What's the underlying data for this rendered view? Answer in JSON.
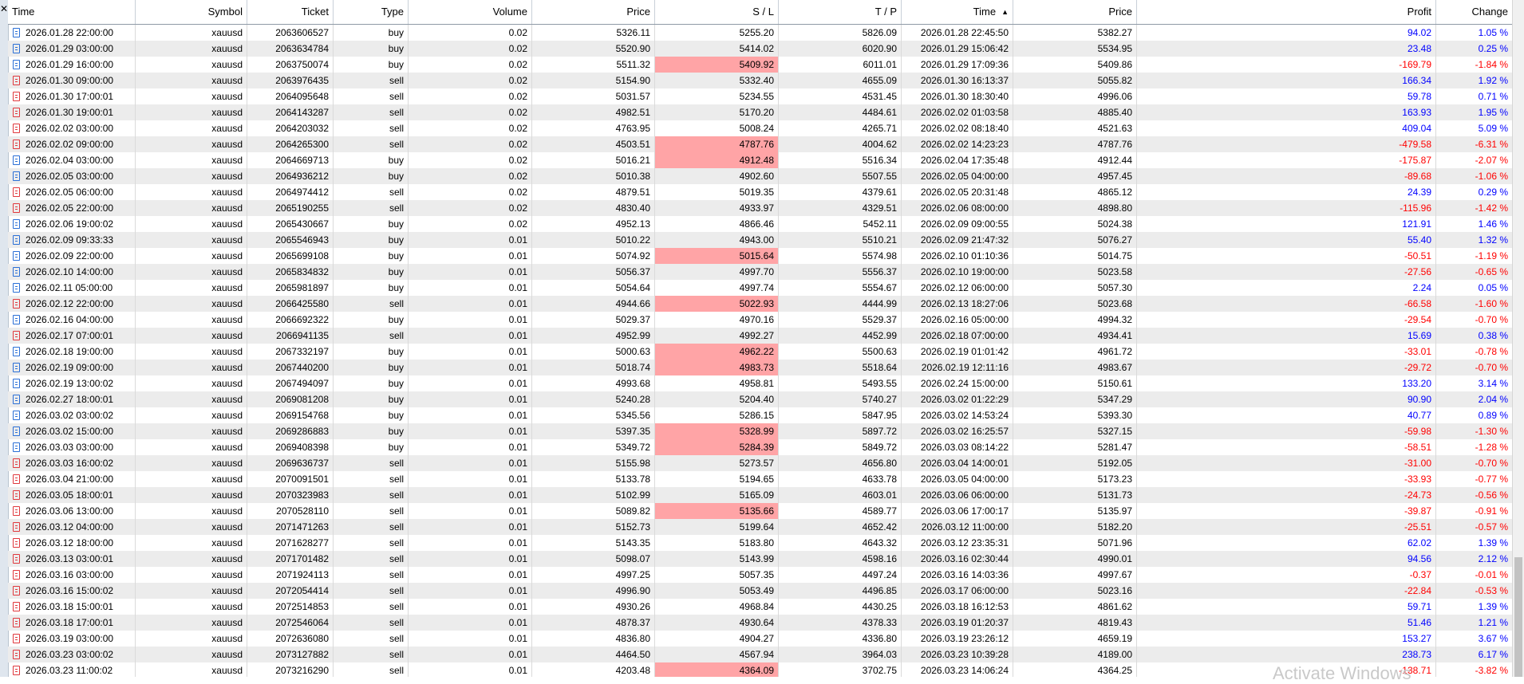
{
  "headers": {
    "time": "Time",
    "symbol": "Symbol",
    "ticket": "Ticket",
    "type": "Type",
    "volume": "Volume",
    "price": "Price",
    "sl": "S / L",
    "tp": "T / P",
    "close_time": "Time",
    "close_price": "Price",
    "profit": "Profit",
    "change": "Change"
  },
  "close_icon": "close-icon",
  "watermark": "Activate Windows",
  "colors": {
    "profit_positive": "#0000ff",
    "profit_negative": "#ff0000",
    "sl_highlight": "#ffa4a6",
    "row_alt": "#ececec"
  },
  "rows": [
    {
      "time": "2026.01.28 22:00:00",
      "symbol": "xauusd",
      "ticket": "2063606527",
      "type": "buy",
      "volume": "0.02",
      "price": "5326.11",
      "sl": "5255.20",
      "sl_hit": false,
      "tp": "5826.09",
      "close_time": "2026.01.28 22:45:50",
      "close_price": "5382.27",
      "profit": "94.02",
      "change": "1.05 %"
    },
    {
      "time": "2026.01.29 03:00:00",
      "symbol": "xauusd",
      "ticket": "2063634784",
      "type": "buy",
      "volume": "0.02",
      "price": "5520.90",
      "sl": "5414.02",
      "sl_hit": false,
      "tp": "6020.90",
      "close_time": "2026.01.29 15:06:42",
      "close_price": "5534.95",
      "profit": "23.48",
      "change": "0.25 %"
    },
    {
      "time": "2026.01.29 16:00:00",
      "symbol": "xauusd",
      "ticket": "2063750074",
      "type": "buy",
      "volume": "0.02",
      "price": "5511.32",
      "sl": "5409.92",
      "sl_hit": true,
      "tp": "6011.01",
      "close_time": "2026.01.29 17:09:36",
      "close_price": "5409.86",
      "profit": "-169.79",
      "change": "-1.84 %"
    },
    {
      "time": "2026.01.30 09:00:00",
      "symbol": "xauusd",
      "ticket": "2063976435",
      "type": "sell",
      "volume": "0.02",
      "price": "5154.90",
      "sl": "5332.40",
      "sl_hit": false,
      "tp": "4655.09",
      "close_time": "2026.01.30 16:13:37",
      "close_price": "5055.82",
      "profit": "166.34",
      "change": "1.92 %"
    },
    {
      "time": "2026.01.30 17:00:01",
      "symbol": "xauusd",
      "ticket": "2064095648",
      "type": "sell",
      "volume": "0.02",
      "price": "5031.57",
      "sl": "5234.55",
      "sl_hit": false,
      "tp": "4531.45",
      "close_time": "2026.01.30 18:30:40",
      "close_price": "4996.06",
      "profit": "59.78",
      "change": "0.71 %"
    },
    {
      "time": "2026.01.30 19:00:01",
      "symbol": "xauusd",
      "ticket": "2064143287",
      "type": "sell",
      "volume": "0.02",
      "price": "4982.51",
      "sl": "5170.20",
      "sl_hit": false,
      "tp": "4484.61",
      "close_time": "2026.02.02 01:03:58",
      "close_price": "4885.40",
      "profit": "163.93",
      "change": "1.95 %"
    },
    {
      "time": "2026.02.02 03:00:00",
      "symbol": "xauusd",
      "ticket": "2064203032",
      "type": "sell",
      "volume": "0.02",
      "price": "4763.95",
      "sl": "5008.24",
      "sl_hit": false,
      "tp": "4265.71",
      "close_time": "2026.02.02 08:18:40",
      "close_price": "4521.63",
      "profit": "409.04",
      "change": "5.09 %"
    },
    {
      "time": "2026.02.02 09:00:00",
      "symbol": "xauusd",
      "ticket": "2064265300",
      "type": "sell",
      "volume": "0.02",
      "price": "4503.51",
      "sl": "4787.76",
      "sl_hit": true,
      "tp": "4004.62",
      "close_time": "2026.02.02 14:23:23",
      "close_price": "4787.76",
      "profit": "-479.58",
      "change": "-6.31 %"
    },
    {
      "time": "2026.02.04 03:00:00",
      "symbol": "xauusd",
      "ticket": "2064669713",
      "type": "buy",
      "volume": "0.02",
      "price": "5016.21",
      "sl": "4912.48",
      "sl_hit": true,
      "tp": "5516.34",
      "close_time": "2026.02.04 17:35:48",
      "close_price": "4912.44",
      "profit": "-175.87",
      "change": "-2.07 %"
    },
    {
      "time": "2026.02.05 03:00:00",
      "symbol": "xauusd",
      "ticket": "2064936212",
      "type": "buy",
      "volume": "0.02",
      "price": "5010.38",
      "sl": "4902.60",
      "sl_hit": false,
      "tp": "5507.55",
      "close_time": "2026.02.05 04:00:00",
      "close_price": "4957.45",
      "profit": "-89.68",
      "change": "-1.06 %"
    },
    {
      "time": "2026.02.05 06:00:00",
      "symbol": "xauusd",
      "ticket": "2064974412",
      "type": "sell",
      "volume": "0.02",
      "price": "4879.51",
      "sl": "5019.35",
      "sl_hit": false,
      "tp": "4379.61",
      "close_time": "2026.02.05 20:31:48",
      "close_price": "4865.12",
      "profit": "24.39",
      "change": "0.29 %"
    },
    {
      "time": "2026.02.05 22:00:00",
      "symbol": "xauusd",
      "ticket": "2065190255",
      "type": "sell",
      "volume": "0.02",
      "price": "4830.40",
      "sl": "4933.97",
      "sl_hit": false,
      "tp": "4329.51",
      "close_time": "2026.02.06 08:00:00",
      "close_price": "4898.80",
      "profit": "-115.96",
      "change": "-1.42 %"
    },
    {
      "time": "2026.02.06 19:00:02",
      "symbol": "xauusd",
      "ticket": "2065430667",
      "type": "buy",
      "volume": "0.02",
      "price": "4952.13",
      "sl": "4866.46",
      "sl_hit": false,
      "tp": "5452.11",
      "close_time": "2026.02.09 09:00:55",
      "close_price": "5024.38",
      "profit": "121.91",
      "change": "1.46 %"
    },
    {
      "time": "2026.02.09 09:33:33",
      "symbol": "xauusd",
      "ticket": "2065546943",
      "type": "buy",
      "volume": "0.01",
      "price": "5010.22",
      "sl": "4943.00",
      "sl_hit": false,
      "tp": "5510.21",
      "close_time": "2026.02.09 21:47:32",
      "close_price": "5076.27",
      "profit": "55.40",
      "change": "1.32 %"
    },
    {
      "time": "2026.02.09 22:00:00",
      "symbol": "xauusd",
      "ticket": "2065699108",
      "type": "buy",
      "volume": "0.01",
      "price": "5074.92",
      "sl": "5015.64",
      "sl_hit": true,
      "tp": "5574.98",
      "close_time": "2026.02.10 01:10:36",
      "close_price": "5014.75",
      "profit": "-50.51",
      "change": "-1.19 %"
    },
    {
      "time": "2026.02.10 14:00:00",
      "symbol": "xauusd",
      "ticket": "2065834832",
      "type": "buy",
      "volume": "0.01",
      "price": "5056.37",
      "sl": "4997.70",
      "sl_hit": false,
      "tp": "5556.37",
      "close_time": "2026.02.10 19:00:00",
      "close_price": "5023.58",
      "profit": "-27.56",
      "change": "-0.65 %"
    },
    {
      "time": "2026.02.11 05:00:00",
      "symbol": "xauusd",
      "ticket": "2065981897",
      "type": "buy",
      "volume": "0.01",
      "price": "5054.64",
      "sl": "4997.74",
      "sl_hit": false,
      "tp": "5554.67",
      "close_time": "2026.02.12 06:00:00",
      "close_price": "5057.30",
      "profit": "2.24",
      "change": "0.05 %"
    },
    {
      "time": "2026.02.12 22:00:00",
      "symbol": "xauusd",
      "ticket": "2066425580",
      "type": "sell",
      "volume": "0.01",
      "price": "4944.66",
      "sl": "5022.93",
      "sl_hit": true,
      "tp": "4444.99",
      "close_time": "2026.02.13 18:27:06",
      "close_price": "5023.68",
      "profit": "-66.58",
      "change": "-1.60 %"
    },
    {
      "time": "2026.02.16 04:00:00",
      "symbol": "xauusd",
      "ticket": "2066692322",
      "type": "buy",
      "volume": "0.01",
      "price": "5029.37",
      "sl": "4970.16",
      "sl_hit": false,
      "tp": "5529.37",
      "close_time": "2026.02.16 05:00:00",
      "close_price": "4994.32",
      "profit": "-29.54",
      "change": "-0.70 %"
    },
    {
      "time": "2026.02.17 07:00:01",
      "symbol": "xauusd",
      "ticket": "2066941135",
      "type": "sell",
      "volume": "0.01",
      "price": "4952.99",
      "sl": "4992.27",
      "sl_hit": false,
      "tp": "4452.99",
      "close_time": "2026.02.18 07:00:00",
      "close_price": "4934.41",
      "profit": "15.69",
      "change": "0.38 %"
    },
    {
      "time": "2026.02.18 19:00:00",
      "symbol": "xauusd",
      "ticket": "2067332197",
      "type": "buy",
      "volume": "0.01",
      "price": "5000.63",
      "sl": "4962.22",
      "sl_hit": true,
      "tp": "5500.63",
      "close_time": "2026.02.19 01:01:42",
      "close_price": "4961.72",
      "profit": "-33.01",
      "change": "-0.78 %"
    },
    {
      "time": "2026.02.19 09:00:00",
      "symbol": "xauusd",
      "ticket": "2067440200",
      "type": "buy",
      "volume": "0.01",
      "price": "5018.74",
      "sl": "4983.73",
      "sl_hit": true,
      "tp": "5518.64",
      "close_time": "2026.02.19 12:11:16",
      "close_price": "4983.67",
      "profit": "-29.72",
      "change": "-0.70 %"
    },
    {
      "time": "2026.02.19 13:00:02",
      "symbol": "xauusd",
      "ticket": "2067494097",
      "type": "buy",
      "volume": "0.01",
      "price": "4993.68",
      "sl": "4958.81",
      "sl_hit": false,
      "tp": "5493.55",
      "close_time": "2026.02.24 15:00:00",
      "close_price": "5150.61",
      "profit": "133.20",
      "change": "3.14 %"
    },
    {
      "time": "2026.02.27 18:00:01",
      "symbol": "xauusd",
      "ticket": "2069081208",
      "type": "buy",
      "volume": "0.01",
      "price": "5240.28",
      "sl": "5204.40",
      "sl_hit": false,
      "tp": "5740.27",
      "close_time": "2026.03.02 01:22:29",
      "close_price": "5347.29",
      "profit": "90.90",
      "change": "2.04 %"
    },
    {
      "time": "2026.03.02 03:00:02",
      "symbol": "xauusd",
      "ticket": "2069154768",
      "type": "buy",
      "volume": "0.01",
      "price": "5345.56",
      "sl": "5286.15",
      "sl_hit": false,
      "tp": "5847.95",
      "close_time": "2026.03.02 14:53:24",
      "close_price": "5393.30",
      "profit": "40.77",
      "change": "0.89 %"
    },
    {
      "time": "2026.03.02 15:00:00",
      "symbol": "xauusd",
      "ticket": "2069286883",
      "type": "buy",
      "volume": "0.01",
      "price": "5397.35",
      "sl": "5328.99",
      "sl_hit": true,
      "tp": "5897.72",
      "close_time": "2026.03.02 16:25:57",
      "close_price": "5327.15",
      "profit": "-59.98",
      "change": "-1.30 %"
    },
    {
      "time": "2026.03.03 03:00:00",
      "symbol": "xauusd",
      "ticket": "2069408398",
      "type": "buy",
      "volume": "0.01",
      "price": "5349.72",
      "sl": "5284.39",
      "sl_hit": true,
      "tp": "5849.72",
      "close_time": "2026.03.03 08:14:22",
      "close_price": "5281.47",
      "profit": "-58.51",
      "change": "-1.28 %"
    },
    {
      "time": "2026.03.03 16:00:02",
      "symbol": "xauusd",
      "ticket": "2069636737",
      "type": "sell",
      "volume": "0.01",
      "price": "5155.98",
      "sl": "5273.57",
      "sl_hit": false,
      "tp": "4656.80",
      "close_time": "2026.03.04 14:00:01",
      "close_price": "5192.05",
      "profit": "-31.00",
      "change": "-0.70 %"
    },
    {
      "time": "2026.03.04 21:00:00",
      "symbol": "xauusd",
      "ticket": "2070091501",
      "type": "sell",
      "volume": "0.01",
      "price": "5133.78",
      "sl": "5194.65",
      "sl_hit": false,
      "tp": "4633.78",
      "close_time": "2026.03.05 04:00:00",
      "close_price": "5173.23",
      "profit": "-33.93",
      "change": "-0.77 %"
    },
    {
      "time": "2026.03.05 18:00:01",
      "symbol": "xauusd",
      "ticket": "2070323983",
      "type": "sell",
      "volume": "0.01",
      "price": "5102.99",
      "sl": "5165.09",
      "sl_hit": false,
      "tp": "4603.01",
      "close_time": "2026.03.06 06:00:00",
      "close_price": "5131.73",
      "profit": "-24.73",
      "change": "-0.56 %"
    },
    {
      "time": "2026.03.06 13:00:00",
      "symbol": "xauusd",
      "ticket": "2070528110",
      "type": "sell",
      "volume": "0.01",
      "price": "5089.82",
      "sl": "5135.66",
      "sl_hit": true,
      "tp": "4589.77",
      "close_time": "2026.03.06 17:00:17",
      "close_price": "5135.97",
      "profit": "-39.87",
      "change": "-0.91 %"
    },
    {
      "time": "2026.03.12 04:00:00",
      "symbol": "xauusd",
      "ticket": "2071471263",
      "type": "sell",
      "volume": "0.01",
      "price": "5152.73",
      "sl": "5199.64",
      "sl_hit": false,
      "tp": "4652.42",
      "close_time": "2026.03.12 11:00:00",
      "close_price": "5182.20",
      "profit": "-25.51",
      "change": "-0.57 %"
    },
    {
      "time": "2026.03.12 18:00:00",
      "symbol": "xauusd",
      "ticket": "2071628277",
      "type": "sell",
      "volume": "0.01",
      "price": "5143.35",
      "sl": "5183.80",
      "sl_hit": false,
      "tp": "4643.32",
      "close_time": "2026.03.12 23:35:31",
      "close_price": "5071.96",
      "profit": "62.02",
      "change": "1.39 %"
    },
    {
      "time": "2026.03.13 03:00:01",
      "symbol": "xauusd",
      "ticket": "2071701482",
      "type": "sell",
      "volume": "0.01",
      "price": "5098.07",
      "sl": "5143.99",
      "sl_hit": false,
      "tp": "4598.16",
      "close_time": "2026.03.16 02:30:44",
      "close_price": "4990.01",
      "profit": "94.56",
      "change": "2.12 %"
    },
    {
      "time": "2026.03.16 03:00:00",
      "symbol": "xauusd",
      "ticket": "2071924113",
      "type": "sell",
      "volume": "0.01",
      "price": "4997.25",
      "sl": "5057.35",
      "sl_hit": false,
      "tp": "4497.24",
      "close_time": "2026.03.16 14:03:36",
      "close_price": "4997.67",
      "profit": "-0.37",
      "change": "-0.01 %"
    },
    {
      "time": "2026.03.16 15:00:02",
      "symbol": "xauusd",
      "ticket": "2072054414",
      "type": "sell",
      "volume": "0.01",
      "price": "4996.90",
      "sl": "5053.49",
      "sl_hit": false,
      "tp": "4496.85",
      "close_time": "2026.03.17 06:00:00",
      "close_price": "5023.16",
      "profit": "-22.84",
      "change": "-0.53 %"
    },
    {
      "time": "2026.03.18 15:00:01",
      "symbol": "xauusd",
      "ticket": "2072514853",
      "type": "sell",
      "volume": "0.01",
      "price": "4930.26",
      "sl": "4968.84",
      "sl_hit": false,
      "tp": "4430.25",
      "close_time": "2026.03.18 16:12:53",
      "close_price": "4861.62",
      "profit": "59.71",
      "change": "1.39 %"
    },
    {
      "time": "2026.03.18 17:00:01",
      "symbol": "xauusd",
      "ticket": "2072546064",
      "type": "sell",
      "volume": "0.01",
      "price": "4878.37",
      "sl": "4930.64",
      "sl_hit": false,
      "tp": "4378.33",
      "close_time": "2026.03.19 01:20:37",
      "close_price": "4819.43",
      "profit": "51.46",
      "change": "1.21 %"
    },
    {
      "time": "2026.03.19 03:00:00",
      "symbol": "xauusd",
      "ticket": "2072636080",
      "type": "sell",
      "volume": "0.01",
      "price": "4836.80",
      "sl": "4904.27",
      "sl_hit": false,
      "tp": "4336.80",
      "close_time": "2026.03.19 23:26:12",
      "close_price": "4659.19",
      "profit": "153.27",
      "change": "3.67 %"
    },
    {
      "time": "2026.03.23 03:00:02",
      "symbol": "xauusd",
      "ticket": "2073127882",
      "type": "sell",
      "volume": "0.01",
      "price": "4464.50",
      "sl": "4567.94",
      "sl_hit": false,
      "tp": "3964.03",
      "close_time": "2026.03.23 10:39:28",
      "close_price": "4189.00",
      "profit": "238.73",
      "change": "6.17 %"
    },
    {
      "time": "2026.03.23 11:00:02",
      "symbol": "xauusd",
      "ticket": "2073216290",
      "type": "sell",
      "volume": "0.01",
      "price": "4203.48",
      "sl": "4364.09",
      "sl_hit": true,
      "tp": "3702.75",
      "close_time": "2026.03.23 14:06:24",
      "close_price": "4364.25",
      "profit": "-138.71",
      "change": "-3.82 %"
    }
  ]
}
